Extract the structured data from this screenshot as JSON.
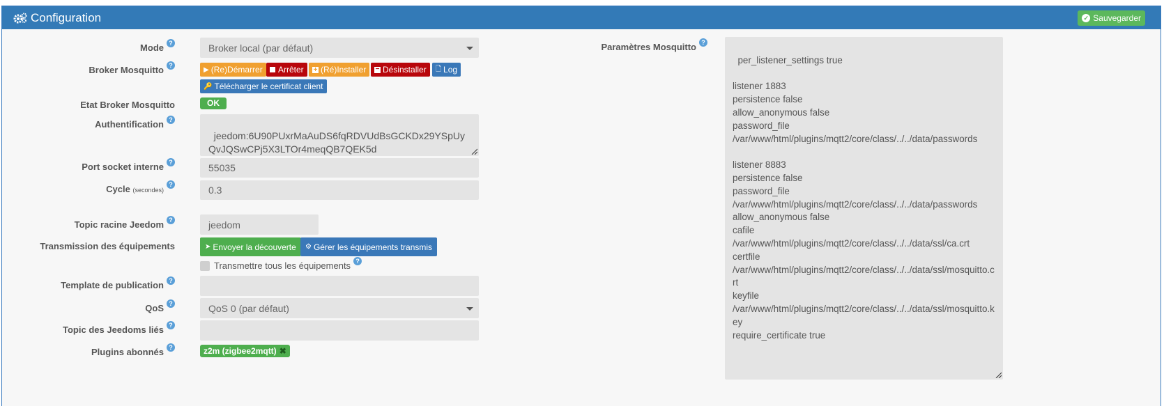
{
  "header": {
    "title": "Configuration",
    "save_label": "Sauvegarder"
  },
  "form": {
    "mode": {
      "label": "Mode",
      "value": "Broker local (par défaut)"
    },
    "broker": {
      "label": "Broker Mosquitto",
      "buttons": {
        "restart": "(Re)Démarrer",
        "stop": "Arrêter",
        "install": "(Ré)Installer",
        "uninstall": "Désinstaller",
        "log": "Log",
        "download_cert": "Télécharger le certificat client"
      }
    },
    "broker_state": {
      "label": "Etat Broker Mosquitto",
      "value": "OK"
    },
    "auth": {
      "label": "Authentification",
      "value": "jeedom:6U90PUxrMaAuDS6fqRDVUdBsGCKDx29YSpUyQvJQSwCPj5X3LTOr4meqQB7QEK5d"
    },
    "socket_port": {
      "label": "Port socket interne",
      "value": "55035"
    },
    "cycle": {
      "label": "Cycle",
      "label_small": "(secondes)",
      "value": "0.3"
    },
    "root_topic": {
      "label": "Topic racine Jeedom",
      "value": "jeedom"
    },
    "transmission": {
      "label": "Transmission des équipements",
      "send_discovery": "Envoyer la découverte",
      "manage_transmitted": "Gérer les équipements transmis",
      "transmit_all": "Transmettre tous les équipements"
    },
    "template": {
      "label": "Template de publication",
      "value": ""
    },
    "qos": {
      "label": "QoS",
      "value": "QoS 0 (par défaut)"
    },
    "linked_topics": {
      "label": "Topic des Jeedoms liés",
      "value": ""
    },
    "plugins": {
      "label": "Plugins abonnés",
      "tag": "z2m (zigbee2mqtt)"
    },
    "mosquitto_params": {
      "label": "Paramètres Mosquitto",
      "value": "per_listener_settings true\n\nlistener 1883\npersistence false\nallow_anonymous false\npassword_file\n/var/www/html/plugins/mqtt2/core/class/../../data/passwords\n\nlistener 8883\npersistence false\npassword_file\n/var/www/html/plugins/mqtt2/core/class/../../data/passwords\nallow_anonymous false\ncafile\n/var/www/html/plugins/mqtt2/core/class/../../data/ssl/ca.crt\ncertfile\n/var/www/html/plugins/mqtt2/core/class/../../data/ssl/mosquitto.crt\nkeyfile\n/var/www/html/plugins/mqtt2/core/class/../../data/ssl/mosquitto.key\nrequire_certificate true"
    }
  },
  "colors": {
    "header": "#337ab7",
    "success": "#4eae4e",
    "warning": "#f0a030",
    "danger": "#b8060b",
    "primary": "#3a78b8"
  }
}
